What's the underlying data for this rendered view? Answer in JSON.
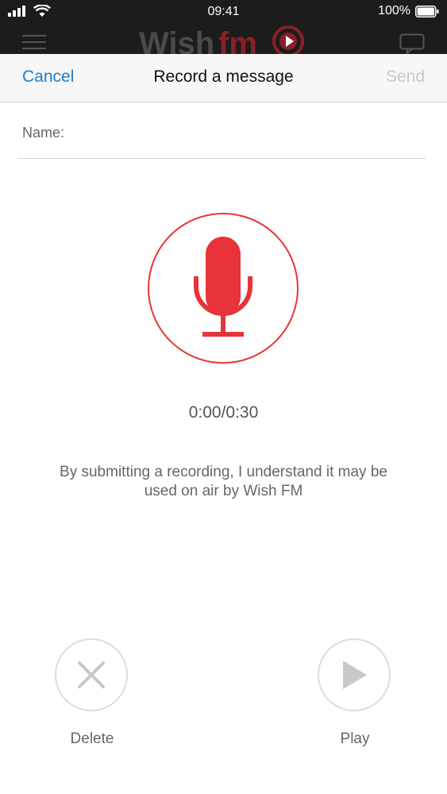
{
  "status_bar": {
    "time": "09:41",
    "battery_percent": "100%",
    "icons": [
      "signal-icon",
      "wifi-icon",
      "battery-icon"
    ]
  },
  "background_app": {
    "icons": [
      "hamburger-menu-icon",
      "wish-fm-logo",
      "chat-icon"
    ]
  },
  "nav": {
    "cancel_label": "Cancel",
    "title": "Record a message",
    "send_label": "Send"
  },
  "form": {
    "name_label": "Name:",
    "name_value": "",
    "name_placeholder": ""
  },
  "recorder": {
    "mic_icon": "microphone-icon",
    "timer": "0:00/0:30",
    "disclaimer": "By submitting a recording, I understand it may be used on air by Wish FM"
  },
  "controls": {
    "delete_label": "Delete",
    "play_label": "Play"
  },
  "colors": {
    "accent_red": "#e83338",
    "link_blue": "#1a7fd0",
    "disabled_gray": "#c8c8c8"
  }
}
